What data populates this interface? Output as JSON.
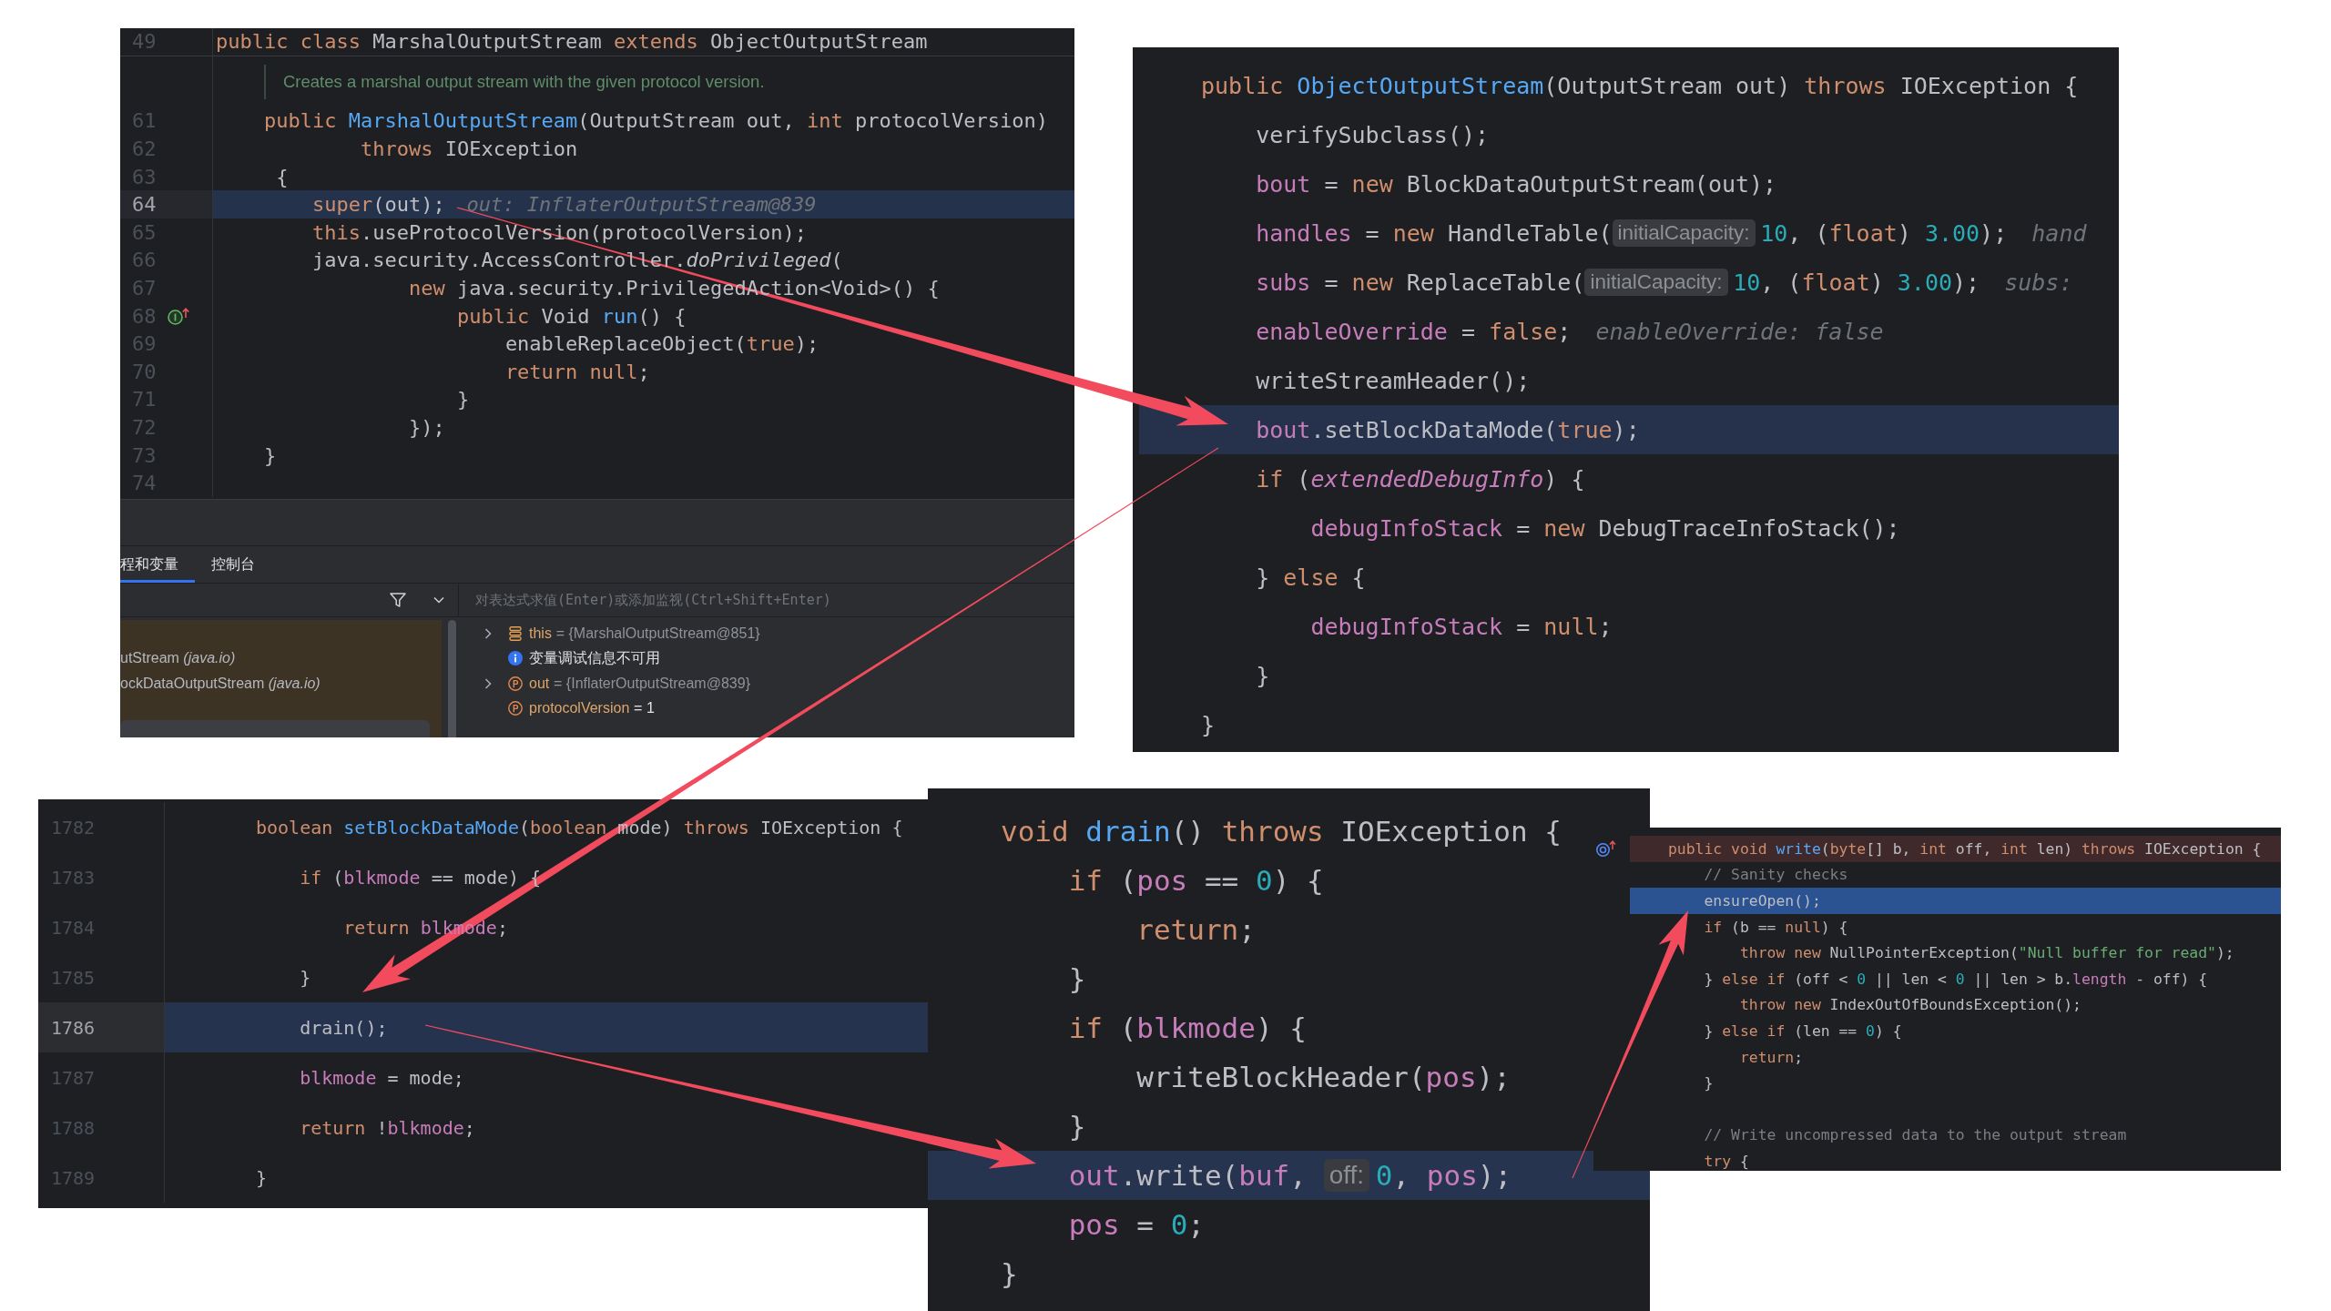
{
  "panels": [
    {
      "sticky_header": {
        "number": "49",
        "tokens": [
          {
            "kind": "keyword",
            "text": "public class"
          },
          {
            "kind": "plain",
            "text": " MarshalOutputStream "
          },
          {
            "kind": "keyword",
            "text": "extends"
          },
          {
            "kind": "plain",
            "text": " ObjectOutputStream"
          }
        ]
      },
      "doc_comment": "Creates a marshal output stream with the given protocol version.",
      "lines": [
        {
          "number": "61",
          "highlighted": false,
          "tokens": [
            {
              "kind": "keyword",
              "text": "    public "
            },
            {
              "kind": "declaration",
              "text": "MarshalOutputStream"
            },
            {
              "kind": "plain",
              "text": "(OutputStream out, "
            },
            {
              "kind": "keyword",
              "text": "int"
            },
            {
              "kind": "plain",
              "text": " protocolVersion)"
            }
          ]
        },
        {
          "number": "62",
          "highlighted": false,
          "tokens": [
            {
              "kind": "keyword",
              "text": "            throws"
            },
            {
              "kind": "plain",
              "text": " IOException"
            }
          ]
        },
        {
          "number": "63",
          "highlighted": false,
          "tokens": [
            {
              "kind": "plain",
              "text": "     {"
            }
          ]
        },
        {
          "number": "64",
          "highlighted": true,
          "tokens": [
            {
              "kind": "keyword",
              "text": "        super"
            },
            {
              "kind": "plain",
              "text": "(out);"
            },
            {
              "kind": "debug_value",
              "text": "out: InflaterOutputStream@839"
            }
          ]
        },
        {
          "number": "65",
          "highlighted": false,
          "tokens": [
            {
              "kind": "keyword",
              "text": "        this"
            },
            {
              "kind": "plain",
              "text": ".useProtocolVersion(protocolVersion);"
            }
          ]
        },
        {
          "number": "66",
          "highlighted": false,
          "tokens": [
            {
              "kind": "plain",
              "text": "        java.security.AccessController."
            },
            {
              "kind": "static_call",
              "text": "doPrivileged"
            },
            {
              "kind": "plain",
              "text": "("
            }
          ]
        },
        {
          "number": "67",
          "highlighted": false,
          "tokens": [
            {
              "kind": "keyword",
              "text": "                new"
            },
            {
              "kind": "plain",
              "text": " java.security.PrivilegedAction<Void>() {"
            }
          ]
        },
        {
          "number": "68",
          "highlighted": false,
          "gutter_icon": {
            "kind": "implements"
          },
          "tokens": [
            {
              "kind": "keyword",
              "text": "                    public"
            },
            {
              "kind": "plain",
              "text": " Void "
            },
            {
              "kind": "declaration",
              "text": "run"
            },
            {
              "kind": "plain",
              "text": "() {"
            }
          ]
        },
        {
          "number": "69",
          "highlighted": false,
          "tokens": [
            {
              "kind": "plain",
              "text": "                        enableReplaceObject("
            },
            {
              "kind": "keyword",
              "text": "true"
            },
            {
              "kind": "plain",
              "text": ");"
            }
          ]
        },
        {
          "number": "70",
          "highlighted": false,
          "tokens": [
            {
              "kind": "keyword",
              "text": "                        return null"
            },
            {
              "kind": "plain",
              "text": ";"
            }
          ]
        },
        {
          "number": "71",
          "highlighted": false,
          "tokens": [
            {
              "kind": "plain",
              "text": "                    }"
            }
          ]
        },
        {
          "number": "72",
          "highlighted": false,
          "tokens": [
            {
              "kind": "plain",
              "text": "                });"
            }
          ]
        },
        {
          "number": "73",
          "highlighted": false,
          "tokens": [
            {
              "kind": "plain",
              "text": "    }"
            }
          ]
        },
        {
          "number": "74",
          "highlighted": false
        }
      ],
      "debugger": {
        "tabs": [
          {
            "label": "程和变量",
            "selected": true
          },
          {
            "label": "控制台",
            "selected": false
          }
        ],
        "expression": {
          "placeholder": "对表达式求值(Enter)或添加监视(Ctrl+Shift+Enter)"
        },
        "frames": [
          {
            "text": "utStream *(java.io)*"
          },
          {
            "text": "ockDataOutputStream *(java.io)*"
          }
        ],
        "variables": [
          {
            "kind": "object",
            "expandable": true,
            "name": "this",
            "value": "= {MarshalOutputStream@851}",
            "reference": true
          },
          {
            "kind": "info",
            "expandable": false,
            "text": "变量调试信息不可用"
          },
          {
            "kind": "parameter",
            "expandable": true,
            "name": "out",
            "value": "= {InflaterOutputStream@839}",
            "reference": true
          },
          {
            "kind": "parameter",
            "expandable": false,
            "name": "protocolVersion",
            "value": "= 1",
            "reference": false
          }
        ]
      }
    },
    {
      "lines": [
        {
          "highlighted": false,
          "tokens": [
            {
              "kind": "keyword",
              "text": "public "
            },
            {
              "kind": "declaration",
              "text": "ObjectOutputStream"
            },
            {
              "kind": "plain",
              "text": "(OutputStream out) "
            },
            {
              "kind": "keyword",
              "text": "throws"
            },
            {
              "kind": "plain",
              "text": " IOException {"
            }
          ]
        },
        {
          "highlighted": false,
          "tokens": [
            {
              "kind": "plain",
              "text": "    verifySubclass();"
            }
          ]
        },
        {
          "highlighted": false,
          "tokens": [
            {
              "kind": "field",
              "text": "    bout"
            },
            {
              "kind": "plain",
              "text": " = "
            },
            {
              "kind": "keyword",
              "text": "new"
            },
            {
              "kind": "plain",
              "text": " BlockDataOutputStream(out);"
            }
          ]
        },
        {
          "highlighted": false,
          "tokens": [
            {
              "kind": "field",
              "text": "    handles"
            },
            {
              "kind": "plain",
              "text": " = "
            },
            {
              "kind": "keyword",
              "text": "new"
            },
            {
              "kind": "plain",
              "text": " HandleTable("
            },
            {
              "kind": "inlay_hint",
              "text": "initialCapacity:"
            },
            {
              "kind": "number",
              "text": "10"
            },
            {
              "kind": "plain",
              "text": ", ("
            },
            {
              "kind": "keyword",
              "text": "float"
            },
            {
              "kind": "plain",
              "text": ") "
            },
            {
              "kind": "number",
              "text": "3.00"
            },
            {
              "kind": "plain",
              "text": ");"
            },
            {
              "kind": "debug_value",
              "text": "hand"
            }
          ]
        },
        {
          "highlighted": false,
          "tokens": [
            {
              "kind": "field",
              "text": "    subs"
            },
            {
              "kind": "plain",
              "text": " = "
            },
            {
              "kind": "keyword",
              "text": "new"
            },
            {
              "kind": "plain",
              "text": " ReplaceTable("
            },
            {
              "kind": "inlay_hint",
              "text": "initialCapacity:"
            },
            {
              "kind": "number",
              "text": "10"
            },
            {
              "kind": "plain",
              "text": ", ("
            },
            {
              "kind": "keyword",
              "text": "float"
            },
            {
              "kind": "plain",
              "text": ") "
            },
            {
              "kind": "number",
              "text": "3.00"
            },
            {
              "kind": "plain",
              "text": ");"
            },
            {
              "kind": "debug_value",
              "text": "subs:"
            }
          ]
        },
        {
          "highlighted": false,
          "tokens": [
            {
              "kind": "field",
              "text": "    enableOverride"
            },
            {
              "kind": "plain",
              "text": " = "
            },
            {
              "kind": "keyword",
              "text": "false"
            },
            {
              "kind": "plain",
              "text": ";"
            },
            {
              "kind": "debug_value",
              "text": "enableOverride: false"
            }
          ]
        },
        {
          "highlighted": false,
          "tokens": [
            {
              "kind": "plain",
              "text": "    writeStreamHeader();"
            }
          ]
        },
        {
          "highlighted": true,
          "tokens": [
            {
              "kind": "field",
              "text": "    bout"
            },
            {
              "kind": "plain",
              "text": ".setBlockDataMode("
            },
            {
              "kind": "keyword",
              "text": "true"
            },
            {
              "kind": "plain",
              "text": ");"
            }
          ]
        },
        {
          "highlighted": false,
          "tokens": [
            {
              "kind": "keyword",
              "text": "    if"
            },
            {
              "kind": "plain",
              "text": " ("
            },
            {
              "kind": "static_field",
              "text": "extendedDebugInfo"
            },
            {
              "kind": "plain",
              "text": ") {"
            }
          ]
        },
        {
          "highlighted": false,
          "tokens": [
            {
              "kind": "field",
              "text": "        debugInfoStack"
            },
            {
              "kind": "plain",
              "text": " = "
            },
            {
              "kind": "keyword",
              "text": "new"
            },
            {
              "kind": "plain",
              "text": " DebugTraceInfoStack();"
            }
          ]
        },
        {
          "highlighted": false,
          "tokens": [
            {
              "kind": "plain",
              "text": "    } "
            },
            {
              "kind": "keyword",
              "text": "else"
            },
            {
              "kind": "plain",
              "text": " {"
            }
          ]
        },
        {
          "highlighted": false,
          "tokens": [
            {
              "kind": "field",
              "text": "        debugInfoStack"
            },
            {
              "kind": "plain",
              "text": " = "
            },
            {
              "kind": "keyword",
              "text": "null"
            },
            {
              "kind": "plain",
              "text": ";"
            }
          ]
        },
        {
          "highlighted": false,
          "tokens": [
            {
              "kind": "plain",
              "text": "    }"
            }
          ]
        },
        {
          "highlighted": false,
          "tokens": [
            {
              "kind": "plain",
              "text": "}"
            }
          ]
        }
      ]
    },
    {
      "lines": [
        {
          "number": "1782",
          "highlighted": false,
          "tokens": [
            {
              "kind": "keyword",
              "text": "boolean "
            },
            {
              "kind": "declaration",
              "text": "setBlockDataMode"
            },
            {
              "kind": "plain",
              "text": "("
            },
            {
              "kind": "keyword",
              "text": "boolean"
            },
            {
              "kind": "plain",
              "text": " mode) "
            },
            {
              "kind": "keyword",
              "text": "throws"
            },
            {
              "kind": "plain",
              "text": " IOException {"
            }
          ]
        },
        {
          "number": "1783",
          "highlighted": false,
          "tokens": [
            {
              "kind": "keyword",
              "text": "    if"
            },
            {
              "kind": "plain",
              "text": " ("
            },
            {
              "kind": "field",
              "text": "blkmode"
            },
            {
              "kind": "plain",
              "text": " == mode) {"
            }
          ]
        },
        {
          "number": "1784",
          "highlighted": false,
          "tokens": [
            {
              "kind": "keyword",
              "text": "        return "
            },
            {
              "kind": "field",
              "text": "blkmode"
            },
            {
              "kind": "plain",
              "text": ";"
            }
          ]
        },
        {
          "number": "1785",
          "highlighted": false,
          "tokens": [
            {
              "kind": "plain",
              "text": "    }"
            }
          ]
        },
        {
          "number": "1786",
          "highlighted": true,
          "tokens": [
            {
              "kind": "plain",
              "text": "    drain();"
            }
          ]
        },
        {
          "number": "1787",
          "highlighted": false,
          "tokens": [
            {
              "kind": "field",
              "text": "    blkmode"
            },
            {
              "kind": "plain",
              "text": " = mode;"
            }
          ]
        },
        {
          "number": "1788",
          "highlighted": false,
          "tokens": [
            {
              "kind": "keyword",
              "text": "    return"
            },
            {
              "kind": "plain",
              "text": " !"
            },
            {
              "kind": "field",
              "text": "blkmode"
            },
            {
              "kind": "plain",
              "text": ";"
            }
          ]
        },
        {
          "number": "1789",
          "highlighted": false,
          "tokens": [
            {
              "kind": "plain",
              "text": "}"
            }
          ]
        }
      ]
    },
    {
      "lines": [
        {
          "highlighted": false,
          "tokens": [
            {
              "kind": "keyword",
              "text": "void "
            },
            {
              "kind": "declaration",
              "text": "drain"
            },
            {
              "kind": "plain",
              "text": "() "
            },
            {
              "kind": "keyword",
              "text": "throws"
            },
            {
              "kind": "plain",
              "text": " IOException {"
            }
          ]
        },
        {
          "highlighted": false,
          "tokens": [
            {
              "kind": "keyword",
              "text": "    if"
            },
            {
              "kind": "plain",
              "text": " ("
            },
            {
              "kind": "field",
              "text": "pos"
            },
            {
              "kind": "plain",
              "text": " == "
            },
            {
              "kind": "number",
              "text": "0"
            },
            {
              "kind": "plain",
              "text": ") {"
            }
          ]
        },
        {
          "highlighted": false,
          "tokens": [
            {
              "kind": "keyword",
              "text": "        return"
            },
            {
              "kind": "plain",
              "text": ";"
            }
          ]
        },
        {
          "highlighted": false,
          "tokens": [
            {
              "kind": "plain",
              "text": "    }"
            }
          ]
        },
        {
          "highlighted": false,
          "tokens": [
            {
              "kind": "keyword",
              "text": "    if"
            },
            {
              "kind": "plain",
              "text": " ("
            },
            {
              "kind": "field",
              "text": "blkmode"
            },
            {
              "kind": "plain",
              "text": ") {"
            }
          ]
        },
        {
          "highlighted": false,
          "tokens": [
            {
              "kind": "plain",
              "text": "        writeBlockHeader("
            },
            {
              "kind": "field",
              "text": "pos"
            },
            {
              "kind": "plain",
              "text": ");"
            }
          ]
        },
        {
          "highlighted": false,
          "tokens": [
            {
              "kind": "plain",
              "text": "    }"
            }
          ]
        },
        {
          "highlighted": true,
          "tokens": [
            {
              "kind": "field",
              "text": "    out"
            },
            {
              "kind": "plain",
              "text": ".write("
            },
            {
              "kind": "field",
              "text": "buf"
            },
            {
              "kind": "plain",
              "text": ", "
            },
            {
              "kind": "inlay_hint",
              "text": "off:"
            },
            {
              "kind": "number",
              "text": "0"
            },
            {
              "kind": "plain",
              "text": ", "
            },
            {
              "kind": "field",
              "text": "pos"
            },
            {
              "kind": "plain",
              "text": ");"
            }
          ]
        },
        {
          "highlighted": false,
          "tokens": [
            {
              "kind": "field",
              "text": "    pos"
            },
            {
              "kind": "plain",
              "text": " = "
            },
            {
              "kind": "number",
              "text": "0"
            },
            {
              "kind": "plain",
              "text": ";"
            }
          ]
        },
        {
          "highlighted": false,
          "tokens": [
            {
              "kind": "plain",
              "text": "}"
            }
          ]
        }
      ]
    },
    {
      "lines": [
        {
          "highlighted": false,
          "breakpoint": true,
          "gutter_icon": {
            "kind": "overrides"
          },
          "tokens": [
            {
              "kind": "keyword",
              "text": "public void "
            },
            {
              "kind": "declaration",
              "text": "write"
            },
            {
              "kind": "plain",
              "text": "("
            },
            {
              "kind": "keyword",
              "text": "byte"
            },
            {
              "kind": "plain",
              "text": "[] b, "
            },
            {
              "kind": "keyword",
              "text": "int"
            },
            {
              "kind": "plain",
              "text": " off, "
            },
            {
              "kind": "keyword",
              "text": "int"
            },
            {
              "kind": "plain",
              "text": " len) "
            },
            {
              "kind": "keyword",
              "text": "throws"
            },
            {
              "kind": "plain",
              "text": " IOException {"
            }
          ]
        },
        {
          "highlighted": false,
          "breakpoint": false,
          "tokens": [
            {
              "kind": "comment",
              "text": "    // Sanity checks"
            }
          ]
        },
        {
          "highlighted": true,
          "breakpoint": false,
          "tokens": [
            {
              "kind": "plain",
              "text": "    ensureOpen();"
            }
          ]
        },
        {
          "highlighted": false,
          "breakpoint": false,
          "tokens": [
            {
              "kind": "keyword",
              "text": "    if"
            },
            {
              "kind": "plain",
              "text": " (b == "
            },
            {
              "kind": "keyword",
              "text": "null"
            },
            {
              "kind": "plain",
              "text": ") {"
            }
          ]
        },
        {
          "highlighted": false,
          "breakpoint": false,
          "tokens": [
            {
              "kind": "keyword",
              "text": "        throw new"
            },
            {
              "kind": "plain",
              "text": " NullPointerException("
            },
            {
              "kind": "string",
              "text": "\"Null buffer for read\""
            },
            {
              "kind": "plain",
              "text": ");"
            }
          ]
        },
        {
          "highlighted": false,
          "breakpoint": false,
          "tokens": [
            {
              "kind": "plain",
              "text": "    } "
            },
            {
              "kind": "keyword",
              "text": "else if"
            },
            {
              "kind": "plain",
              "text": " (off < "
            },
            {
              "kind": "number",
              "text": "0"
            },
            {
              "kind": "plain",
              "text": " || len < "
            },
            {
              "kind": "number",
              "text": "0"
            },
            {
              "kind": "plain",
              "text": " || len > b."
            },
            {
              "kind": "field",
              "text": "length"
            },
            {
              "kind": "plain",
              "text": " - off) {"
            }
          ]
        },
        {
          "highlighted": false,
          "breakpoint": false,
          "tokens": [
            {
              "kind": "keyword",
              "text": "        throw new"
            },
            {
              "kind": "plain",
              "text": " IndexOutOfBoundsException();"
            }
          ]
        },
        {
          "highlighted": false,
          "breakpoint": false,
          "tokens": [
            {
              "kind": "plain",
              "text": "    } "
            },
            {
              "kind": "keyword",
              "text": "else if"
            },
            {
              "kind": "plain",
              "text": " (len == "
            },
            {
              "kind": "number",
              "text": "0"
            },
            {
              "kind": "plain",
              "text": ") {"
            }
          ]
        },
        {
          "highlighted": false,
          "breakpoint": false,
          "tokens": [
            {
              "kind": "keyword",
              "text": "        return"
            },
            {
              "kind": "plain",
              "text": ";"
            }
          ]
        },
        {
          "highlighted": false,
          "breakpoint": false,
          "tokens": [
            {
              "kind": "plain",
              "text": "    }"
            }
          ]
        },
        {
          "highlighted": false,
          "breakpoint": false,
          "tokens": [
            {
              "kind": "comment",
              "text": "    // Write uncompressed data to the output stream"
            }
          ]
        },
        {
          "highlighted": false,
          "breakpoint": false,
          "tokens": [
            {
              "kind": "keyword",
              "text": "    try"
            },
            {
              "kind": "plain",
              "text": " {"
            }
          ]
        }
      ]
    }
  ]
}
